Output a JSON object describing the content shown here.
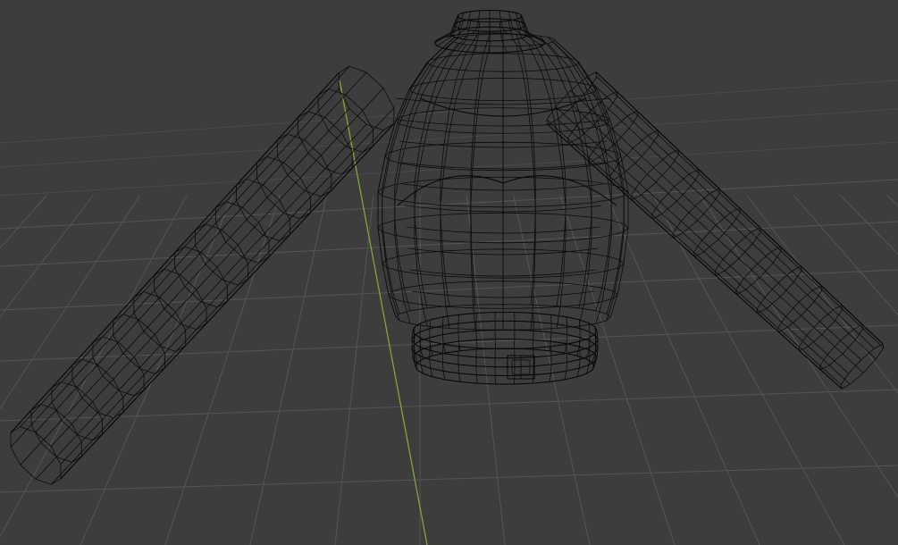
{
  "viewport": {
    "mode": "wireframe",
    "background_color": "#3d3d3d",
    "grid_color": "#555555",
    "wire_color": "#0c0c0c",
    "y_axis_color": "#7fa83a"
  },
  "object": {
    "name": "sweater-wireframe-mesh",
    "parts": [
      "collar",
      "torso",
      "left-sleeve",
      "right-sleeve",
      "waistband",
      "buckle"
    ]
  }
}
